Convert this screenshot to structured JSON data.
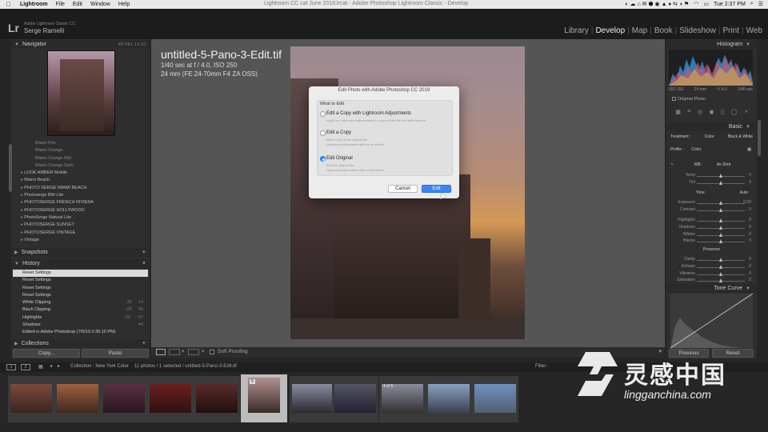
{
  "menubar": {
    "apple": "",
    "items": [
      "Lightroom",
      "File",
      "Edit",
      "Window",
      "Help"
    ],
    "window_title": "Lightroom CC cat June 2018.lrcat - Adobe Photoshop Lightroom Classic - Develop",
    "clock": "Tue 2:37 PM"
  },
  "header": {
    "logo": "Lr",
    "product": "Adobe Lightroom Classic CC",
    "user": "Serge Ramelli",
    "modules": [
      "Library",
      "Develop",
      "Map",
      "Book",
      "Slideshow",
      "Print",
      "Web"
    ],
    "active_module": "Develop"
  },
  "left": {
    "navigator": {
      "title": "Navigator",
      "zoom": "FIT  FILL  1:1  3:1"
    },
    "presets": [
      {
        "label": "Miami Fire",
        "sub": true
      },
      {
        "label": "Miami Orange",
        "sub": true
      },
      {
        "label": "Miami Orange Mid",
        "sub": true
      },
      {
        "label": "Miami Orange Dark",
        "sub": true
      },
      {
        "label": "LOOK AMBER Mobile",
        "sub": false
      },
      {
        "label": "Miami Beach",
        "sub": false
      },
      {
        "label": "PHOTO SERGE MIAMI BEACH",
        "sub": false
      },
      {
        "label": "Photoserge BW Lite",
        "sub": false
      },
      {
        "label": "PHOTOSERGE FRENCH RIVIERA",
        "sub": false
      },
      {
        "label": "PHOTOSERGE HOLLYWOOD",
        "sub": false
      },
      {
        "label": "PhotoSerge Natural Lite",
        "sub": false
      },
      {
        "label": "PHOTOSERGE SUNSET",
        "sub": false
      },
      {
        "label": "PHOTOSERGE VINTAGE",
        "sub": false
      },
      {
        "label": "Vintage",
        "sub": false
      }
    ],
    "snapshots": "Snapshots",
    "history_title": "History",
    "history": [
      {
        "label": "Reset Settings",
        "a": "",
        "b": ""
      },
      {
        "label": "Reset Settings",
        "a": "",
        "b": ""
      },
      {
        "label": "Reset Settings",
        "a": "",
        "b": ""
      },
      {
        "label": "Reset Settings",
        "a": "",
        "b": ""
      },
      {
        "label": "White Clipping",
        "a": "-35",
        "b": "14"
      },
      {
        "label": "Black Clipping",
        "a": "-25",
        "b": "45"
      },
      {
        "label": "Highlights",
        "a": "-56",
        "b": "-57"
      },
      {
        "label": "Shadows",
        "a": "",
        "b": "44"
      },
      {
        "label": "Edited in Adobe Photoshop (7/9/19 2:36:10 PM)",
        "a": "",
        "b": ""
      }
    ],
    "collections": "Collections",
    "copy": "Copy...",
    "paste": "Paste"
  },
  "center": {
    "filename": "untitled-5-Pano-3-Edit.tif",
    "exposure": "1/40 sec at f / 4.0, ISO 250",
    "lens": "24 mm (FE 24-70mm F4 ZA OSS)",
    "soft_proofing": "Soft Proofing"
  },
  "modal": {
    "title": "Edit Photo with Adobe Photoshop CC 2019",
    "what_to_edit": "What to Edit",
    "options": [
      {
        "label": "Edit a Copy with Lightroom Adjustments",
        "desc": "Apply the Lightroom adjustments to a copy of the file and edit that one.",
        "selected": false
      },
      {
        "label": "Edit a Copy",
        "desc": "Edit a copy of the original file.\nLightroom adjustments will not be visible.",
        "selected": false
      },
      {
        "label": "Edit Original",
        "desc": "Edit the original file.\nLightroom adjustments will not be visible.",
        "selected": true
      }
    ],
    "cancel": "Cancel",
    "edit": "Edit"
  },
  "right": {
    "histogram_title": "Histogram",
    "hist_info": {
      "iso": "ISO 250",
      "focal": "24 mm",
      "aperture": "f / 4.0",
      "shutter": "1/40 sec"
    },
    "original_photo": "Original Photo",
    "basic": "Basic",
    "treatment_label": "Treatment :",
    "color": "Color",
    "bw": "Black & White",
    "profile_label": "Profile :",
    "profile_value": "Color",
    "wb_label": "WB :",
    "wb_value": "As Shot",
    "tone": "Tone",
    "auto": "Auto",
    "presence": "Presence",
    "sliders": [
      {
        "label": "Temp",
        "value": "0",
        "pos": 0.5
      },
      {
        "label": "Tint",
        "value": "0",
        "pos": 0.5
      },
      {
        "label": "Exposure",
        "value": "0.00",
        "pos": 0.5
      },
      {
        "label": "Contrast",
        "value": "0",
        "pos": 0.5
      },
      {
        "label": "Highlights",
        "value": "0",
        "pos": 0.5
      },
      {
        "label": "Shadows",
        "value": "0",
        "pos": 0.5
      },
      {
        "label": "Whites",
        "value": "0",
        "pos": 0.5
      },
      {
        "label": "Blacks",
        "value": "0",
        "pos": 0.5
      },
      {
        "label": "Clarity",
        "value": "0",
        "pos": 0.5
      },
      {
        "label": "Dehaze",
        "value": "0",
        "pos": 0.5
      },
      {
        "label": "Vibrance",
        "value": "0",
        "pos": 0.5
      },
      {
        "label": "Saturation",
        "value": "0",
        "pos": 0.5
      }
    ],
    "tone_curve": "Tone Curve",
    "previous": "Previous",
    "reset": "Reset"
  },
  "filmbar": {
    "page1": "1",
    "page2": "2",
    "collection": "Collection : New York Color",
    "photos": "11 photos / 1 selected / untitled-5-Pano-3-Edit.tif",
    "filter": "Filter :"
  },
  "filmstrip_badges": {
    "sel": "5",
    "other": "4 of 5"
  },
  "watermark": {
    "cn": "灵感中国",
    "url": "lingganchina.com"
  }
}
